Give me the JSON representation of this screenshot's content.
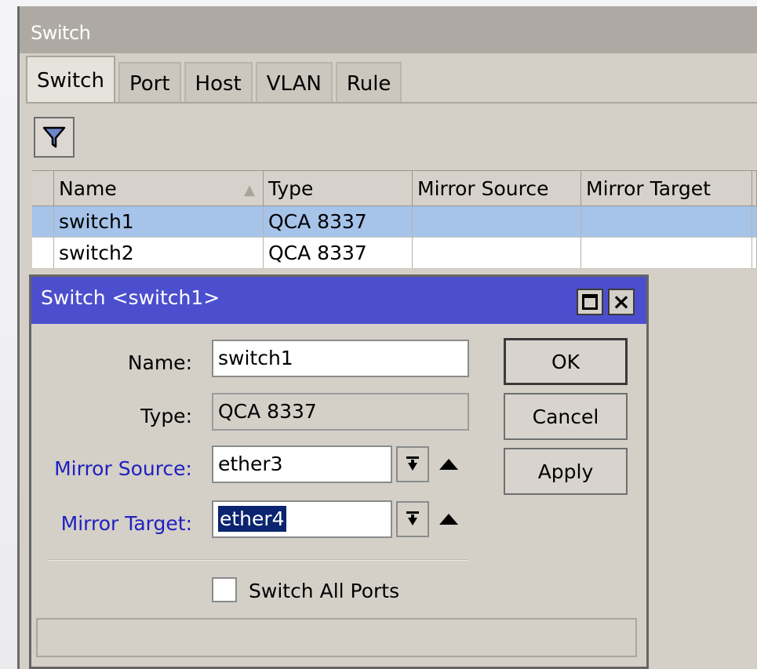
{
  "main": {
    "title": "Switch",
    "tabs": [
      {
        "label": "Switch",
        "active": true
      },
      {
        "label": "Port",
        "active": false
      },
      {
        "label": "Host",
        "active": false
      },
      {
        "label": "VLAN",
        "active": false
      },
      {
        "label": "Rule",
        "active": false
      }
    ],
    "toolbar": {
      "filter_icon": "filter-icon"
    },
    "table": {
      "columns": [
        "Name",
        "Type",
        "Mirror Source",
        "Mirror Target"
      ],
      "rows": [
        {
          "name": "switch1",
          "type": "QCA 8337",
          "mirror_source": "",
          "mirror_target": "",
          "selected": true
        },
        {
          "name": "switch2",
          "type": "QCA 8337",
          "mirror_source": "",
          "mirror_target": "",
          "selected": false
        }
      ]
    }
  },
  "dialog": {
    "title": "Switch <switch1>",
    "fields": {
      "name": {
        "label": "Name:",
        "value": "switch1"
      },
      "type": {
        "label": "Type:",
        "value": "QCA 8337"
      },
      "mirror_source": {
        "label": "Mirror Source:",
        "value": "ether3"
      },
      "mirror_target": {
        "label": "Mirror Target:",
        "value": "ether4"
      }
    },
    "buttons": {
      "ok": "OK",
      "cancel": "Cancel",
      "apply": "Apply"
    },
    "switch_all_ports": {
      "label": "Switch All Ports",
      "checked": false
    },
    "status": ""
  },
  "colors": {
    "dialog_title_bar": "#4c4fcd",
    "label_blue": "#2020c0",
    "row_selected": "#a6c3ea",
    "text_selection": "#0a2470"
  }
}
